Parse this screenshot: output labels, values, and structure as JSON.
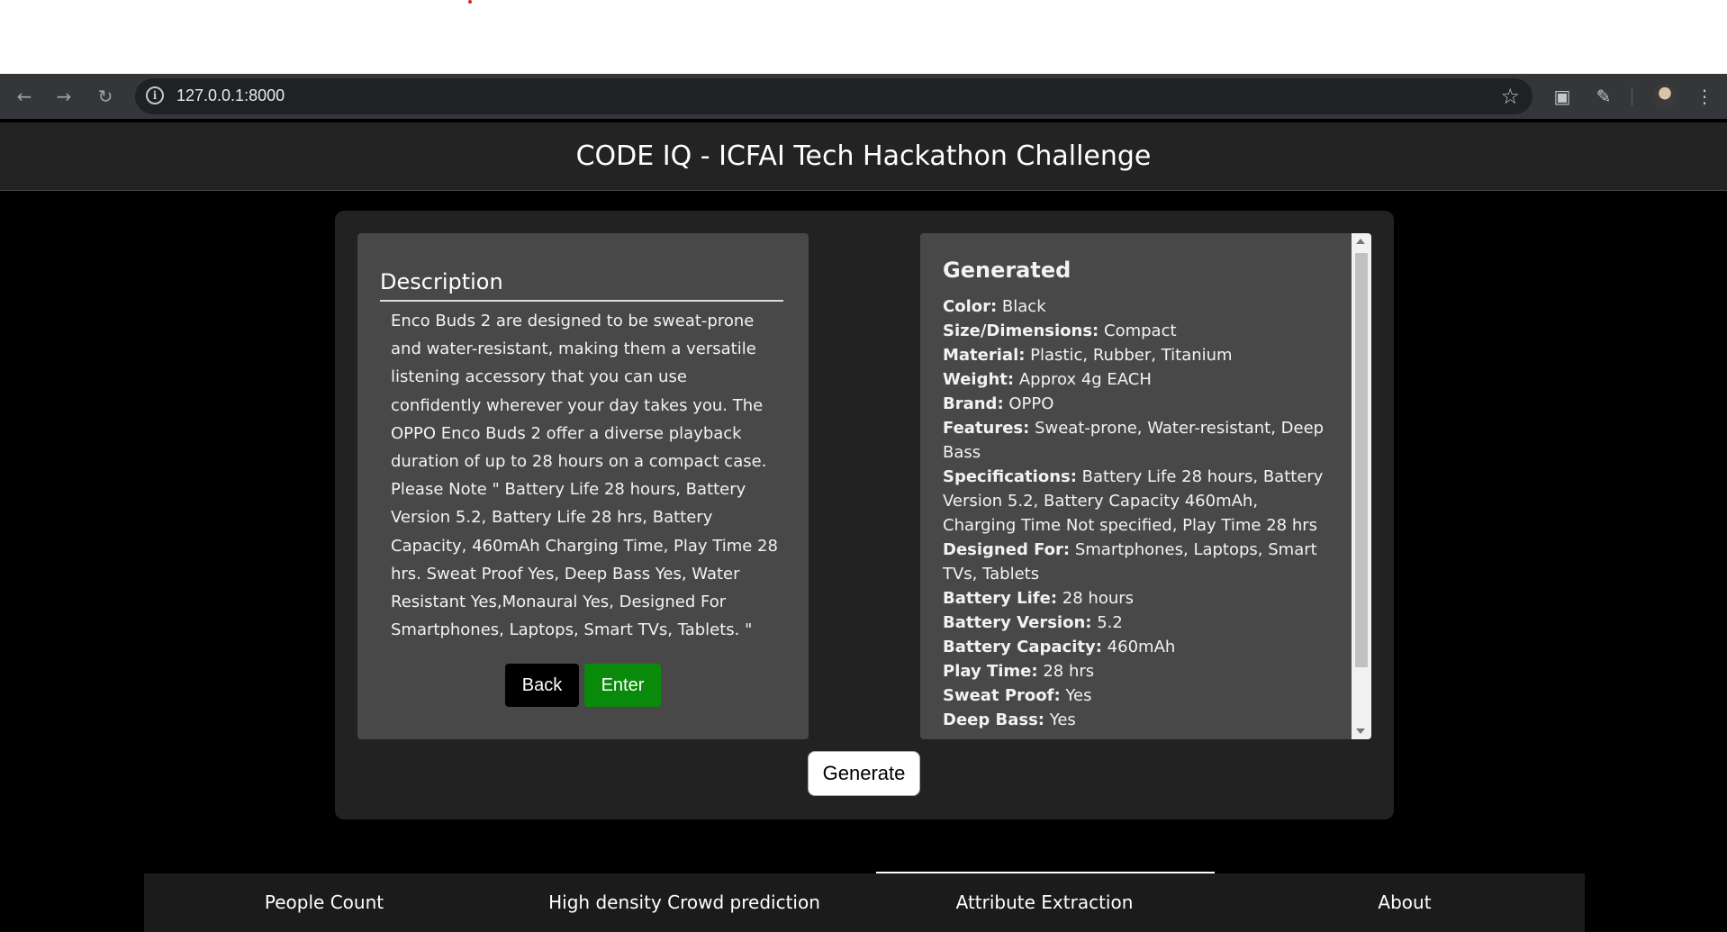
{
  "browser": {
    "url": "127.0.0.1:8000"
  },
  "header": {
    "title": "CODE IQ - ICFAI Tech Hackathon Challenge"
  },
  "description": {
    "title": "Description",
    "text": "Enco Buds 2 are designed to be sweat-prone and water-resistant, making them a versatile listening accessory that you can use confidently wherever your day takes you. The OPPO Enco Buds 2 offer a diverse playback duration of up to 28 hours on a compact case. Please Note \" Battery Life 28 hours, Battery Version 5.2, Battery Life 28 hrs, Battery Capacity, 460mAh Charging Time, Play Time 28 hrs. Sweat Proof Yes, Deep Bass Yes, Water Resistant Yes,Monaural Yes, Designed For Smartphones, Laptops, Smart TVs, Tablets. \"",
    "back_label": "Back",
    "enter_label": "Enter"
  },
  "generated": {
    "title": "Generated",
    "rows": [
      {
        "key": "Color:",
        "value": "Black"
      },
      {
        "key": "Size/Dimensions:",
        "value": "Compact"
      },
      {
        "key": "Material:",
        "value": "Plastic, Rubber, Titanium"
      },
      {
        "key": "Weight:",
        "value": "Approx 4g EACH"
      },
      {
        "key": "Brand:",
        "value": "OPPO"
      },
      {
        "key": "Features:",
        "value": "Sweat-prone, Water-resistant, Deep Bass"
      },
      {
        "key": "Specifications:",
        "value": "Battery Life 28 hours, Battery Version 5.2, Battery Capacity 460mAh, Charging Time Not specified, Play Time 28 hrs"
      },
      {
        "key": "Designed For:",
        "value": "Smartphones, Laptops, Smart TVs, Tablets"
      },
      {
        "key": "Battery Life:",
        "value": "28 hours"
      },
      {
        "key": "Battery Version:",
        "value": "5.2"
      },
      {
        "key": "Battery Capacity:",
        "value": "460mAh"
      },
      {
        "key": "Play Time:",
        "value": "28 hrs"
      },
      {
        "key": "Sweat Proof:",
        "value": "Yes"
      },
      {
        "key": "Deep Bass:",
        "value": "Yes"
      }
    ]
  },
  "generate_label": "Generate",
  "tabs": [
    {
      "label": "People Count"
    },
    {
      "label": "High density Crowd prediction"
    },
    {
      "label": "Attribute Extraction",
      "active": true
    },
    {
      "label": "About"
    }
  ],
  "colors": {
    "enter_button": "#0a8a0a",
    "panel_bg": "#484848",
    "page_bg": "#000000"
  }
}
